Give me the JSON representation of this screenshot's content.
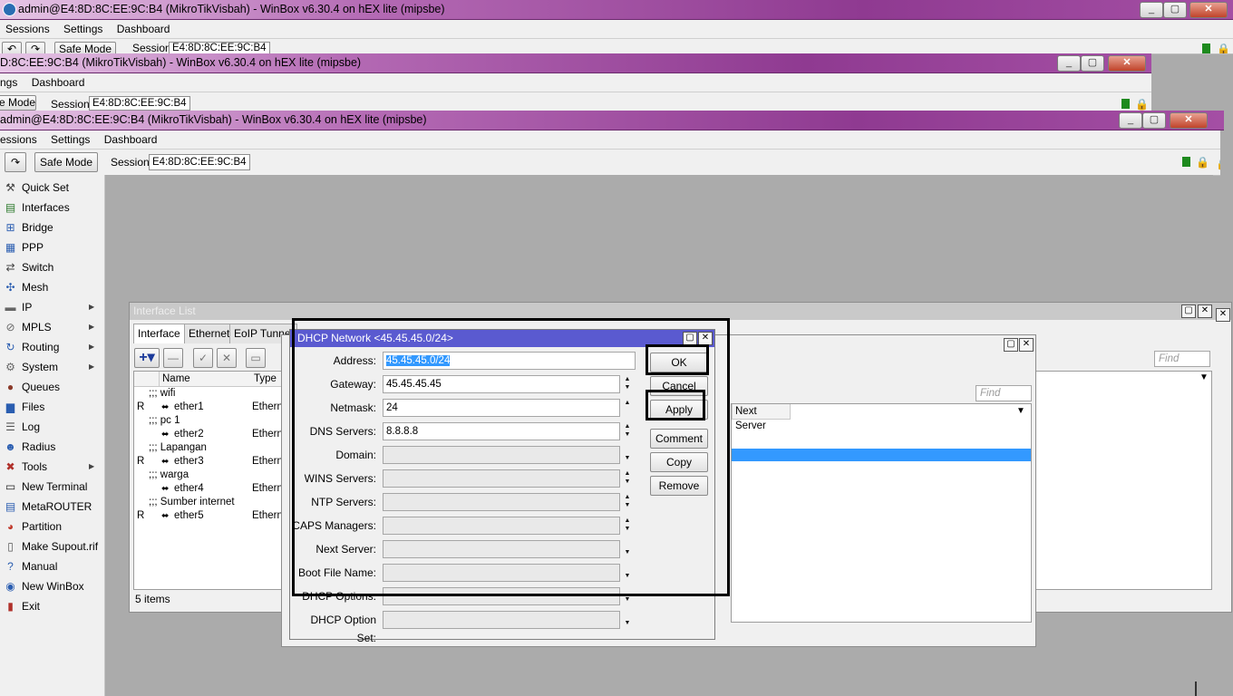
{
  "windows": [
    {
      "title": "admin@E4:8D:8C:EE:9C:B4 (MikroTikVisbah) - WinBox v6.30.4 on hEX lite (mipsbe)"
    },
    {
      "title": "D:8C:EE:9C:B4 (MikroTikVisbah) - WinBox v6.30.4 on hEX lite (mipsbe)"
    },
    {
      "title": "admin@E4:8D:8C:EE:9C:B4 (MikroTikVisbah) - WinBox v6.30.4 on hEX lite (mipsbe)"
    }
  ],
  "menu": {
    "sessions": "Sessions",
    "settings": "Settings",
    "dashboard": "Dashboard",
    "sessions_cut": "essions",
    "settings_cut": "ngs"
  },
  "toolbar": {
    "safe_mode": "Safe Mode",
    "safe_mode_cut": "e Mode",
    "session_label": "Session:",
    "session_value": "E4:8D:8C:EE:9C:B4"
  },
  "sidebar": {
    "items": [
      {
        "label": "Quick Set",
        "icon": "quick-set-icon",
        "sub": false
      },
      {
        "label": "Interfaces",
        "icon": "interfaces-icon",
        "sub": false
      },
      {
        "label": "Bridge",
        "icon": "bridge-icon",
        "sub": false
      },
      {
        "label": "PPP",
        "icon": "ppp-icon",
        "sub": false
      },
      {
        "label": "Switch",
        "icon": "switch-icon",
        "sub": false
      },
      {
        "label": "Mesh",
        "icon": "mesh-icon",
        "sub": false
      },
      {
        "label": "IP",
        "icon": "ip-icon",
        "sub": true
      },
      {
        "label": "MPLS",
        "icon": "mpls-icon",
        "sub": true
      },
      {
        "label": "Routing",
        "icon": "routing-icon",
        "sub": true
      },
      {
        "label": "System",
        "icon": "system-icon",
        "sub": true
      },
      {
        "label": "Queues",
        "icon": "queues-icon",
        "sub": false
      },
      {
        "label": "Files",
        "icon": "files-icon",
        "sub": false
      },
      {
        "label": "Log",
        "icon": "log-icon",
        "sub": false
      },
      {
        "label": "Radius",
        "icon": "radius-icon",
        "sub": false
      },
      {
        "label": "Tools",
        "icon": "tools-icon",
        "sub": true
      },
      {
        "label": "New Terminal",
        "icon": "terminal-icon",
        "sub": false
      },
      {
        "label": "MetaROUTER",
        "icon": "metarouter-icon",
        "sub": false
      },
      {
        "label": "Partition",
        "icon": "partition-icon",
        "sub": false
      },
      {
        "label": "Make Supout.rif",
        "icon": "supout-icon",
        "sub": false
      },
      {
        "label": "Manual",
        "icon": "manual-icon",
        "sub": false
      },
      {
        "label": "New WinBox",
        "icon": "winbox-icon",
        "sub": false
      },
      {
        "label": "Exit",
        "icon": "exit-icon",
        "sub": false
      }
    ]
  },
  "interface_list": {
    "title": "Interface List",
    "tabs": [
      "Interface",
      "Ethernet",
      "EoIP Tunnel"
    ],
    "columns": {
      "name": "Name",
      "type": "Type"
    },
    "rows": [
      {
        "flag": "",
        "name": ";;; wifi",
        "type": "",
        "comment": true
      },
      {
        "flag": "R",
        "name": "ether1",
        "type": "Etherne",
        "comment": false
      },
      {
        "flag": "",
        "name": ";;; pc 1",
        "type": "",
        "comment": true
      },
      {
        "flag": "",
        "name": "ether2",
        "type": "Etherne",
        "comment": false
      },
      {
        "flag": "",
        "name": ";;; Lapangan",
        "type": "",
        "comment": true
      },
      {
        "flag": "R",
        "name": "ether3",
        "type": "Etherne",
        "comment": false
      },
      {
        "flag": "",
        "name": ";;; warga",
        "type": "",
        "comment": true
      },
      {
        "flag": "",
        "name": "ether4",
        "type": "Etherne",
        "comment": false
      },
      {
        "flag": "",
        "name": ";;; Sumber internet",
        "type": "",
        "comment": true
      },
      {
        "flag": "R",
        "name": "ether5",
        "type": "Etherne",
        "comment": false
      }
    ],
    "status": "5 items",
    "find": "Find"
  },
  "dhcp_list": {
    "find": "Find",
    "next_server_col": "Next Server"
  },
  "dialog": {
    "title": "DHCP Network <45.45.45.0/24>",
    "fields": [
      {
        "label": "Address:",
        "value": "45.45.45.0/24",
        "spin": "",
        "disabled": false
      },
      {
        "label": "Gateway:",
        "value": "45.45.45.45",
        "spin": "updown",
        "disabled": false
      },
      {
        "label": "Netmask:",
        "value": "24",
        "spin": "up",
        "disabled": false
      },
      {
        "label": "DNS Servers:",
        "value": "8.8.8.8",
        "spin": "updown",
        "disabled": false
      },
      {
        "label": "Domain:",
        "value": "",
        "spin": "down",
        "disabled": true
      },
      {
        "label": "WINS Servers:",
        "value": "",
        "spin": "updown",
        "disabled": true
      },
      {
        "label": "NTP Servers:",
        "value": "",
        "spin": "updown",
        "disabled": true
      },
      {
        "label": "CAPS Managers:",
        "value": "",
        "spin": "updown",
        "disabled": true
      },
      {
        "label": "Next Server:",
        "value": "",
        "spin": "down",
        "disabled": true
      },
      {
        "label": "Boot File Name:",
        "value": "",
        "spin": "down",
        "disabled": true
      },
      {
        "label": "DHCP Options:",
        "value": "",
        "spin": "down",
        "disabled": true
      },
      {
        "label": "DHCP Option Set:",
        "value": "",
        "spin": "down",
        "disabled": true
      }
    ],
    "buttons": {
      "ok": "OK",
      "cancel": "Cancel",
      "apply": "Apply",
      "comment": "Comment",
      "copy": "Copy",
      "remove": "Remove"
    }
  },
  "colors": {
    "title_purple": "#8f3a91",
    "dialog_title": "#5a5ad0",
    "selection": "#3399ff"
  }
}
